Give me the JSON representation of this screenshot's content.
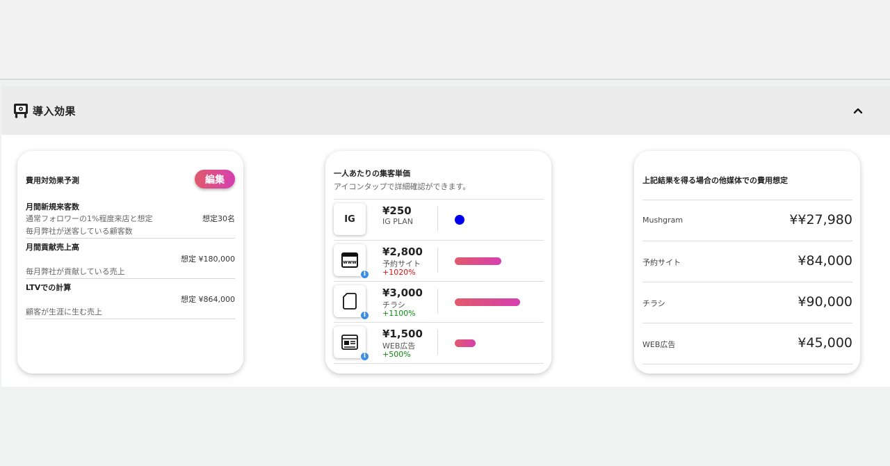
{
  "section": {
    "title": "導入効果"
  },
  "effect_card": {
    "title": "費用対効果予測",
    "edit_label": "編集",
    "metrics": [
      {
        "title": "月間新規来客数",
        "line1": "通常フォロワーの1%程度来店と想定",
        "value": "想定30名",
        "line2": "毎月弊社が送客している顧客数"
      },
      {
        "title": "月間貢献売上高",
        "value": "想定 ¥180,000",
        "line2": "毎月弊社が貢献している売上"
      },
      {
        "title": "LTVでの計算",
        "value": "想定 ¥864,000",
        "line2": "顧客が生涯に生む売上"
      }
    ]
  },
  "unit_price_card": {
    "title": "一人あたりの集客単価",
    "subtitle": "アイコンタップで詳細確認ができます。",
    "items": [
      {
        "icon_text": "IG",
        "icon": "ig-badge",
        "price": "¥250",
        "name": "IG PLAN",
        "delta": "",
        "bar_fraction": 0
      },
      {
        "icon_text": "",
        "icon": "browser-www-icon",
        "price": "¥2,800",
        "name": "予約サイト",
        "delta": "+1020%",
        "delta_color": "#e01010",
        "bar_fraction": 0.56
      },
      {
        "icon_text": "",
        "icon": "document-icon",
        "price": "¥3,000",
        "name": "チラシ",
        "delta": "+1100%",
        "delta_color": "#0a8a0a",
        "bar_fraction": 0.78
      },
      {
        "icon_text": "",
        "icon": "web-article-icon",
        "price": "¥1,500",
        "name": "WEB広告",
        "delta": "+500%",
        "delta_color": "#0a8a0a",
        "bar_fraction": 0.25
      }
    ],
    "info_glyph": "i"
  },
  "cost_card": {
    "title": "上記結果を得る場合の他媒体での費用想定",
    "rows": [
      {
        "label": "Mushgram",
        "value": "¥¥27,980"
      },
      {
        "label": "予約サイト",
        "value": "¥84,000"
      },
      {
        "label": "チラシ",
        "value": "¥90,000"
      },
      {
        "label": "WEB広告",
        "value": "¥45,000"
      }
    ]
  },
  "colors": {
    "accent_gradient_start": "#e05a6a",
    "accent_gradient_end": "#d63fb0",
    "ig_dot": "#0000ee",
    "info_blue": "#3a8de0"
  }
}
